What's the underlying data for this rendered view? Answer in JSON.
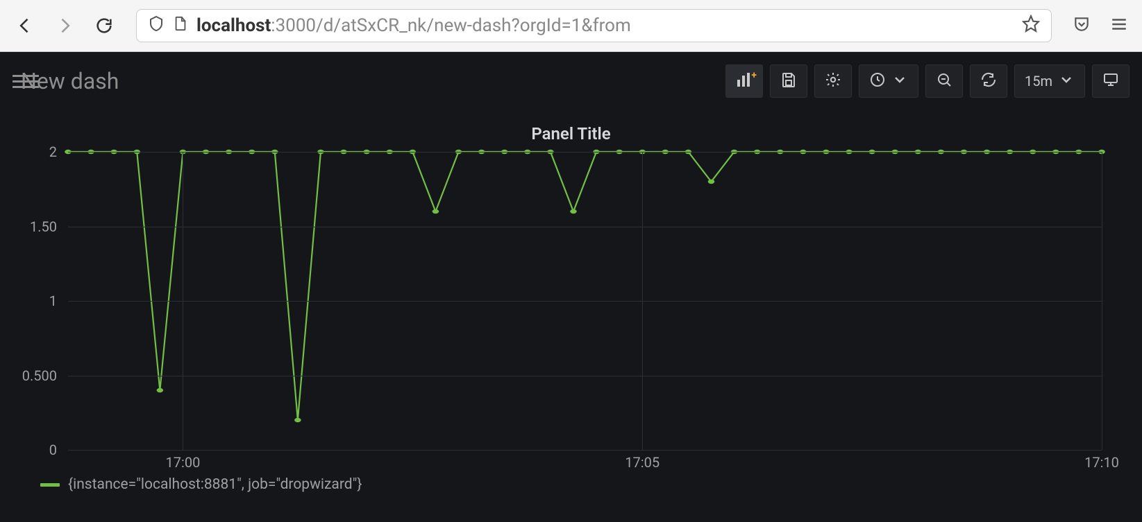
{
  "browser": {
    "url_host": "localhost",
    "url_rest": ":3000/d/atSxCR_nk/new-dash?orgId=1&from"
  },
  "dashboard": {
    "title": "New dash",
    "refresh_label": "15m"
  },
  "panel": {
    "title": "Panel Title",
    "legend": "{instance=\"localhost:8881\", job=\"dropwizard\"}"
  },
  "chart_data": {
    "type": "line",
    "title": "Panel Title",
    "xlabel": "",
    "ylabel": "",
    "ylim": [
      0,
      2
    ],
    "y_ticks": [
      0,
      0.5,
      1,
      1.5,
      2
    ],
    "y_tick_labels": [
      "0",
      "0.500",
      "1",
      "1.50",
      "2"
    ],
    "x_tick_labels": [
      "17:00",
      "17:05",
      "17:10"
    ],
    "x_tick_indices": [
      5,
      25,
      45
    ],
    "series": [
      {
        "name": "{instance=\"localhost:8881\", job=\"dropwizard\"}",
        "color": "#73bf46",
        "values": [
          2,
          2,
          2,
          2,
          0.4,
          2,
          2,
          2,
          2,
          2,
          0.2,
          2,
          2,
          2,
          2,
          2,
          1.6,
          2,
          2,
          2,
          2,
          2,
          1.6,
          2,
          2,
          2,
          2,
          2,
          1.8,
          2,
          2,
          2,
          2,
          2,
          2,
          2,
          2,
          2,
          2,
          2,
          2,
          2,
          2,
          2,
          2,
          2
        ]
      }
    ]
  }
}
